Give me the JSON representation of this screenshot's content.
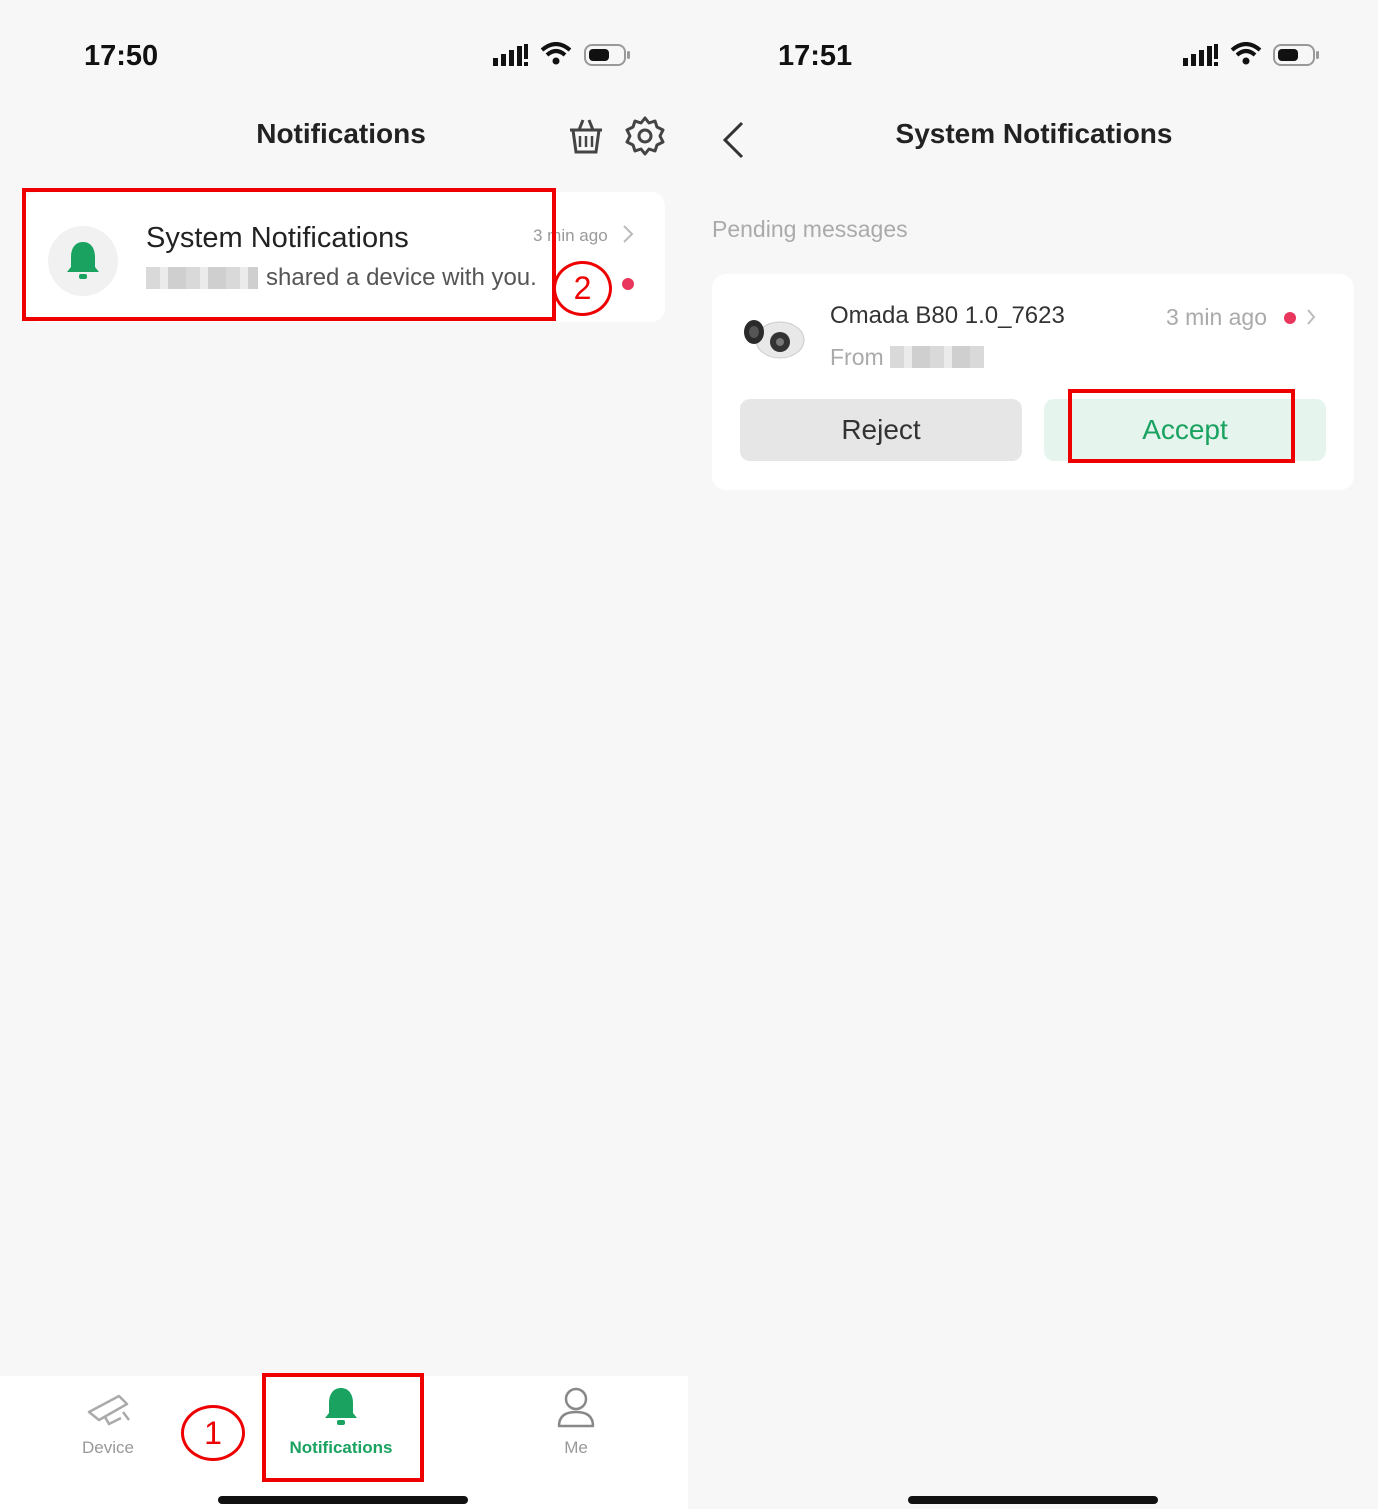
{
  "left": {
    "status_time": "17:50",
    "header_title": "Notifications",
    "notification": {
      "title": "System Notifications",
      "time": "3 min ago",
      "message": "shared a device with you."
    },
    "annotation_1": "1",
    "annotation_2": "2",
    "tabs": [
      {
        "label": "Device"
      },
      {
        "label": "Notifications"
      },
      {
        "label": "Me"
      }
    ]
  },
  "right": {
    "status_time": "17:51",
    "header_title": "System Notifications",
    "section_label": "Pending messages",
    "message": {
      "device_name": "Omada B80 1.0_7623",
      "time": "3 min ago",
      "from_label": "From",
      "reject_label": "Reject",
      "accept_label": "Accept"
    }
  },
  "colors": {
    "accent_green": "#1aa260",
    "unread_dot": "#e8365d",
    "highlight_red": "#e00000"
  }
}
